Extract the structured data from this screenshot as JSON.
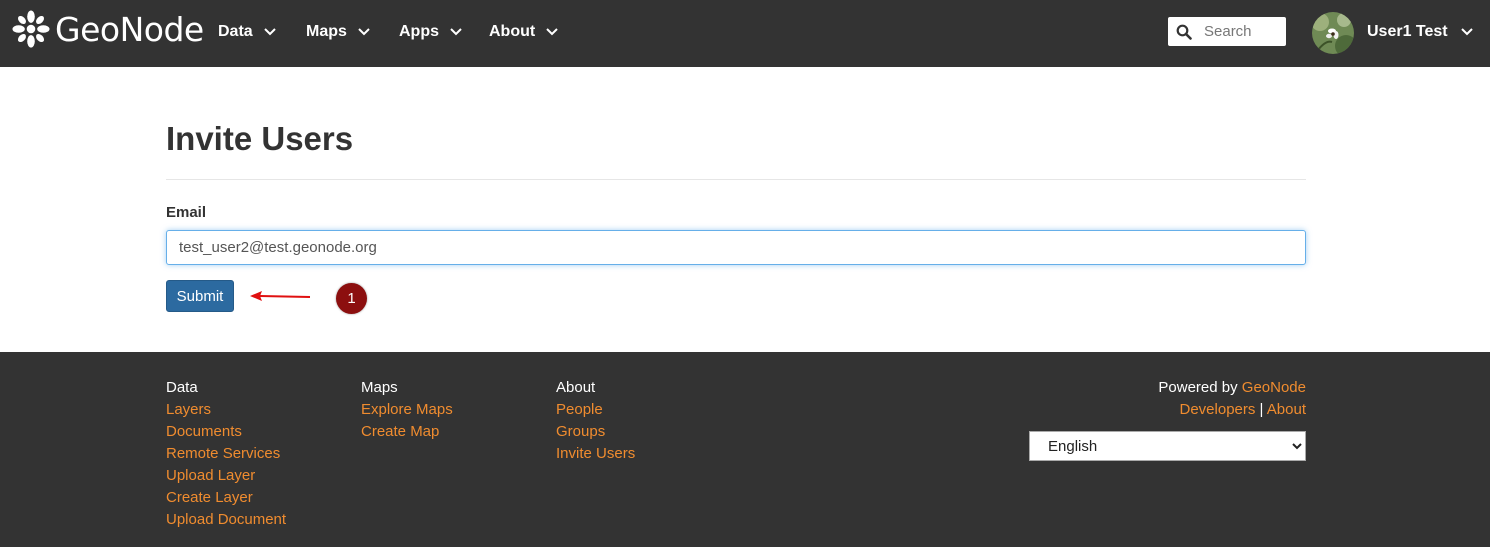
{
  "navbar": {
    "brand": "GeoNode",
    "menus": [
      {
        "label": "Data"
      },
      {
        "label": "Maps"
      },
      {
        "label": "Apps"
      },
      {
        "label": "About"
      }
    ],
    "search_placeholder": "Search",
    "user_name": "User1 Test"
  },
  "main": {
    "title": "Invite Users",
    "email_label": "Email",
    "email_value": "test_user2@test.geonode.org",
    "submit_label": "Submit",
    "step_badge": "1"
  },
  "footer": {
    "columns": [
      {
        "heading": "Data",
        "links": [
          "Layers",
          "Documents",
          "Remote Services",
          "Upload Layer",
          "Create Layer",
          "Upload Document"
        ]
      },
      {
        "heading": "Maps",
        "links": [
          "Explore Maps",
          "Create Map"
        ]
      },
      {
        "heading": "About",
        "links": [
          "People",
          "Groups",
          "Invite Users"
        ]
      }
    ],
    "powered_by": "Powered by",
    "powered_link": "GeoNode",
    "developers_link": "Developers",
    "separator": "|",
    "about_link": "About",
    "language": "English"
  },
  "colors": {
    "navbar_bg": "#333333",
    "link_orange": "#f08c2f",
    "primary_button": "#2c6aa0",
    "badge_red": "#8c0f0f",
    "arrow_red": "#e01010"
  }
}
